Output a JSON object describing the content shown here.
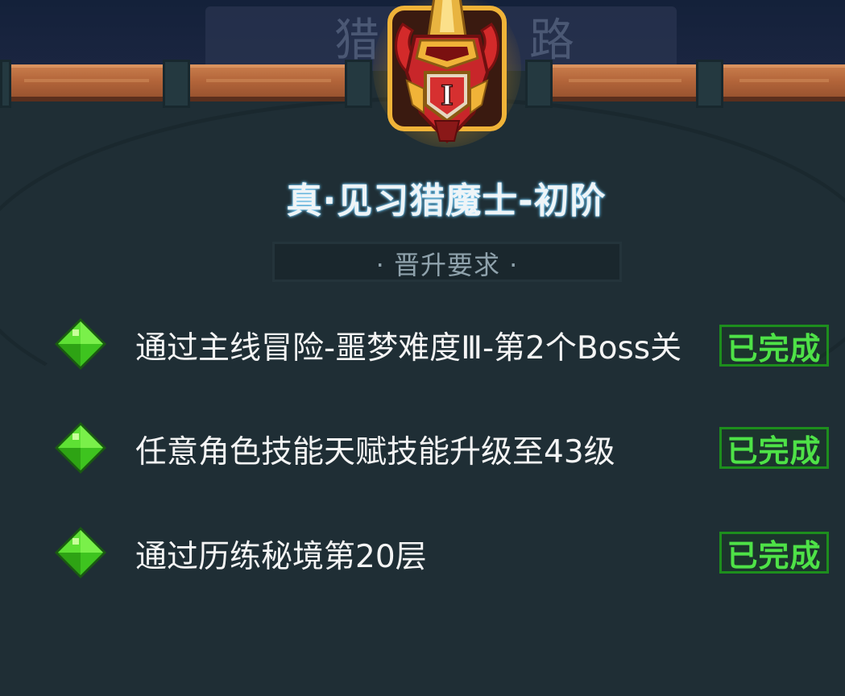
{
  "header": {
    "bg_title_chars": [
      "猎",
      "路"
    ]
  },
  "emblem": {
    "rank_numeral": "I",
    "icon": "demon-hunter-helmet-icon"
  },
  "rank_title": "真·见习猎魔士-初阶",
  "requirements": {
    "label": "· 晋升要求 ·",
    "items": [
      {
        "text": "通过主线冒险-噩梦难度Ⅲ-第2个Boss关",
        "status": "已完成",
        "icon": "green-gem-icon"
      },
      {
        "text": "任意角色技能天赋技能升级至43级",
        "status": "已完成",
        "icon": "green-gem-icon"
      },
      {
        "text": "通过历练秘境第20层",
        "status": "已完成",
        "icon": "green-gem-icon"
      }
    ]
  },
  "colors": {
    "background": "#1f2e35",
    "complete_green": "#4ee247",
    "badge_border": "#1d8e1d",
    "title_glow": "#7bd3ff"
  }
}
